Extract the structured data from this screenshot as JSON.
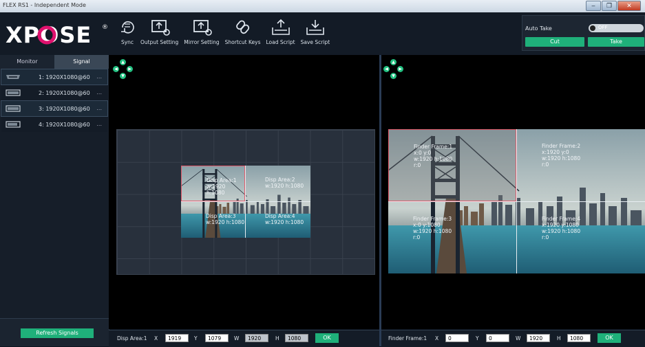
{
  "window": {
    "title": "FLEX RS1 - Independent Mode",
    "min": "‒",
    "max": "❐",
    "close": "✕"
  },
  "brand": {
    "logo_text": "XPOSE",
    "reg_mark": "®"
  },
  "toolbar": {
    "items": [
      {
        "label": "Sync",
        "icon": "sync-icon"
      },
      {
        "label": "Output Setting",
        "icon": "output-setting-icon"
      },
      {
        "label": "Mirror Setting",
        "icon": "mirror-setting-icon"
      },
      {
        "label": "Shortcut Keys",
        "icon": "link-icon"
      },
      {
        "label": "Load Script",
        "icon": "load-script-icon"
      },
      {
        "label": "Save Script",
        "icon": "save-script-icon"
      }
    ]
  },
  "take_panel": {
    "auto_take_label": "Auto Take",
    "toggle_state": "OFF",
    "cut_label": "Cut",
    "take_label": "Take"
  },
  "left_panel": {
    "tabs": [
      {
        "label": "Monitor"
      },
      {
        "label": "Signal"
      }
    ],
    "signals": [
      {
        "label": "1: 1920X1080@60",
        "more": "...",
        "icon": "hdmi-icon"
      },
      {
        "label": "2: 1920X1080@60",
        "more": "...",
        "icon": "displayport-icon"
      },
      {
        "label": "3: 1920X1080@60",
        "more": "...",
        "icon": "displayport-icon"
      },
      {
        "label": "4: 1920X1080@60",
        "more": "...",
        "icon": "dvi-icon"
      }
    ],
    "refresh_label": "Refresh Signals"
  },
  "disp_areas": [
    {
      "title": "Disp Area:1",
      "size": "w:1920  h:1080"
    },
    {
      "title": "Disp Area:2",
      "size": "w:1920  h:1080"
    },
    {
      "title": "Disp Area:3",
      "size": "w:1920  h:1080"
    },
    {
      "title": "Disp Area:4",
      "size": "w:1920  h:1080"
    }
  ],
  "finder_frames": [
    {
      "title": "Finder Frame:1",
      "pos": "x:0  y:0",
      "size": "w:1920  h:1080",
      "rot": "r:0"
    },
    {
      "title": "Finder Frame:2",
      "pos": "x:1920  y:0",
      "size": "w:1920  h:1080",
      "rot": "r:0"
    },
    {
      "title": "Finder Frame:3",
      "pos": "x:0  y:1080",
      "size": "w:1920  h:1080",
      "rot": "r:0"
    },
    {
      "title": "Finder Frame:4",
      "pos": "x:1920  y:1080",
      "size": "w:1920  h:1080",
      "rot": "r:0"
    }
  ],
  "disp_bar": {
    "label": "Disp Area:1",
    "x_label": "X",
    "x": "1919",
    "y_label": "Y",
    "y": "1079",
    "w_label": "W",
    "w": "1920",
    "h_label": "H",
    "h": "1080",
    "ok": "OK"
  },
  "finder_bar": {
    "label": "Finder Frame:1",
    "x_label": "X",
    "x": "0",
    "y_label": "Y",
    "y": "0",
    "w_label": "W",
    "w": "1920",
    "h_label": "H",
    "h": "1080",
    "ok": "OK"
  },
  "colors": {
    "accent": "#1fb07a",
    "nav_dot": "#23c282",
    "background": "#0c1420"
  }
}
